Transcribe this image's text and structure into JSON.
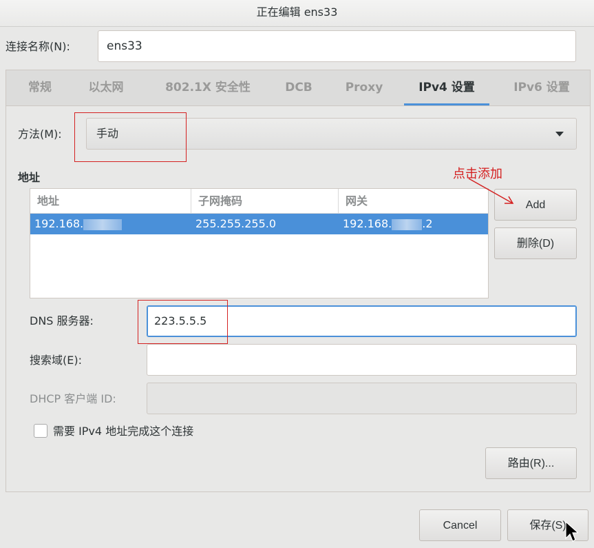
{
  "window": {
    "title": "正在编辑 ens33"
  },
  "connection": {
    "label": "连接名称(N):",
    "value": "ens33"
  },
  "tabs": [
    {
      "label": "常规"
    },
    {
      "label": "以太网"
    },
    {
      "label": "802.1X 安全性"
    },
    {
      "label": "DCB"
    },
    {
      "label": "Proxy"
    },
    {
      "label": "IPv4 设置",
      "active": true
    },
    {
      "label": "IPv6 设置"
    }
  ],
  "method": {
    "label": "方法(M):",
    "value": "手动"
  },
  "addresses": {
    "section_title": "地址",
    "columns": [
      "地址",
      "子网掩码",
      "网关"
    ],
    "rows": [
      {
        "address": "192.168.",
        "netmask": "255.255.255.0",
        "gateway": "192.168.",
        "gateway_tail": ".2"
      }
    ],
    "add_label": "Add",
    "delete_label": "删除(D)"
  },
  "dns": {
    "label": "DNS 服务器:",
    "value": "223.5.5.5"
  },
  "search": {
    "label": "搜索域(E):",
    "value": ""
  },
  "dhcp": {
    "label": "DHCP 客户端 ID:",
    "value": ""
  },
  "require_ipv4": {
    "label": "需要 IPv4 地址完成这个连接",
    "checked": false
  },
  "routes_label": "路由(R)...",
  "footer": {
    "cancel_label": "Cancel",
    "save_label": "保存(S)"
  },
  "annotation": {
    "text": "点击添加"
  },
  "colors": {
    "accent": "#4a90d9",
    "annotation": "#d42020"
  }
}
